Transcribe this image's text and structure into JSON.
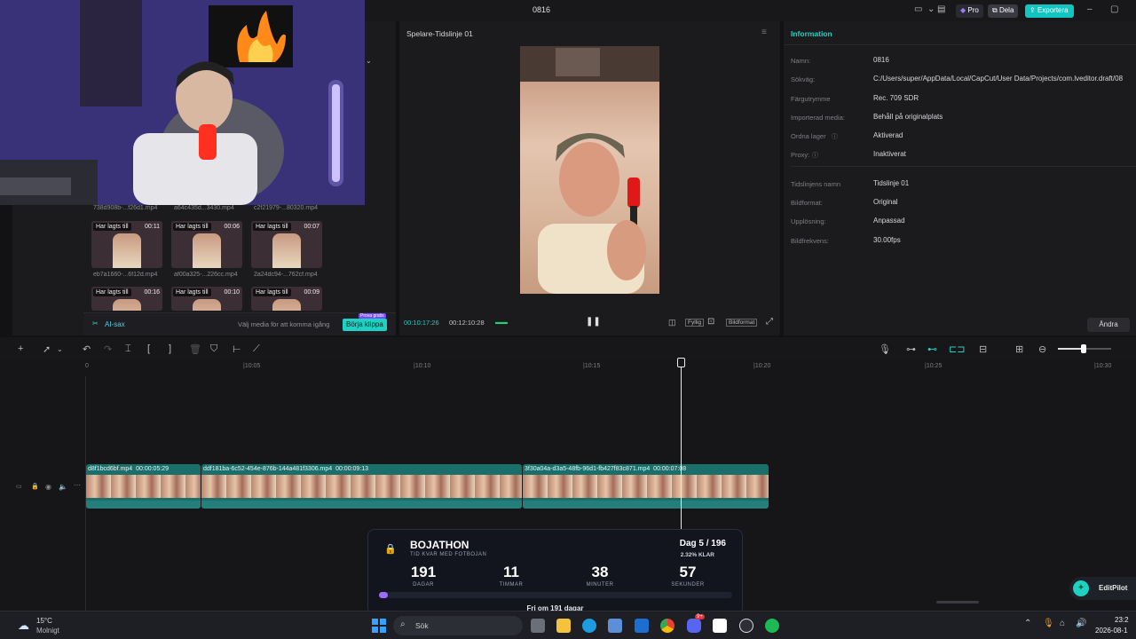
{
  "app": {
    "title": "0816",
    "pro_label": "Pro",
    "share_label": "Dela",
    "export_label": "Exportera"
  },
  "media": {
    "top_names": [
      "738d908b-...f26d1.mp4",
      "a64c435d...3430.mp4",
      "c2f21979-...80320.mp4"
    ],
    "rows": [
      [
        {
          "tag": "Har lagts till",
          "dur": "00:11",
          "name": "eb7a1660-...6f12d.mp4"
        },
        {
          "tag": "Har lagts till",
          "dur": "00:06",
          "name": "af00a325-...226cc.mp4"
        },
        {
          "tag": "Har lagts till",
          "dur": "00:07",
          "name": "2a24dc94-...762cf.mp4"
        }
      ],
      [
        {
          "tag": "Har lagts till",
          "dur": "00:16",
          "name": ""
        },
        {
          "tag": "Har lagts till",
          "dur": "00:10",
          "name": ""
        },
        {
          "tag": "Har lagts till",
          "dur": "00:09",
          "name": ""
        }
      ]
    ],
    "ai_label": "AI-sax",
    "hint": "Välj media för att komma igång",
    "start_button": "Börja klippa",
    "promo_badge": "Prova gratis"
  },
  "player": {
    "title": "Spelare-Tidslinje 01",
    "current_time": "00:10:17:26",
    "total_time": "00:12:10:28",
    "fit_label": "Fyllig",
    "ratio_label": "Bildformat"
  },
  "info": {
    "tab": "Information",
    "rows": [
      {
        "label": "Namn:",
        "value": "0816"
      },
      {
        "label": "Sökväg:",
        "value": "C:/Users/super/AppData/Local/CapCut/User Data/Projects/com.lveditor.draft/08"
      },
      {
        "label": "Färgutrymme",
        "value": "Rec. 709 SDR"
      },
      {
        "label": "Importerad media:",
        "value": "Behåll på originalplats"
      },
      {
        "label": "Ordna lager",
        "value": "Aktiverad"
      },
      {
        "label": "Proxy:",
        "value": "Inaktiverat"
      }
    ],
    "rows2": [
      {
        "label": "Tidslinjens namn",
        "value": "Tidslinje 01"
      },
      {
        "label": "Bildformat:",
        "value": "Original"
      },
      {
        "label": "Upplösning:",
        "value": "Anpassad"
      },
      {
        "label": "Bildfrekvens:",
        "value": "30.00fps"
      }
    ],
    "edit_button": "Ändra"
  },
  "timeline": {
    "ticks": [
      "0",
      "|10:05",
      "|10:10",
      "|10:15",
      "|10:20",
      "|10:25",
      "|10:30"
    ],
    "clips": [
      {
        "name": "d8f1bcd6bf.mp4",
        "dur": "00:00:05:29"
      },
      {
        "name": "ddf181ba-6c52-454e-876b-144a481f3306.mp4",
        "dur": "00:00:09:13"
      },
      {
        "name": "3f30a04a-d3a5-48fb-96d1-fb427f83c871.mp4",
        "dur": "00:00:07:08"
      }
    ]
  },
  "overlay": {
    "title": "BOJATHON",
    "subtitle": "TID KVAR MED FOTBOJAN",
    "day": "Dag 5 / 196",
    "percent": "2.32% KLAR",
    "progress_fraction": 0.0232,
    "counters": [
      {
        "value": "191",
        "label": "DAGAR"
      },
      {
        "value": "11",
        "label": "TIMMAR"
      },
      {
        "value": "38",
        "label": "MINUTER"
      },
      {
        "value": "57",
        "label": "SEKUNDER"
      }
    ],
    "footer": "Fri om 191 dagar"
  },
  "editpilot": {
    "label": "EditPilot"
  },
  "taskbar": {
    "temp": "15°C",
    "weather": "Molnigt",
    "search": "Sök",
    "time": "23:2",
    "date": "2026-08-1",
    "discord_badge": "9+"
  },
  "colors": {
    "accent": "#1fd1c2",
    "clip": "#1b6f6b",
    "export_bg": "#12c5c0",
    "promo": "#7a4cff"
  }
}
